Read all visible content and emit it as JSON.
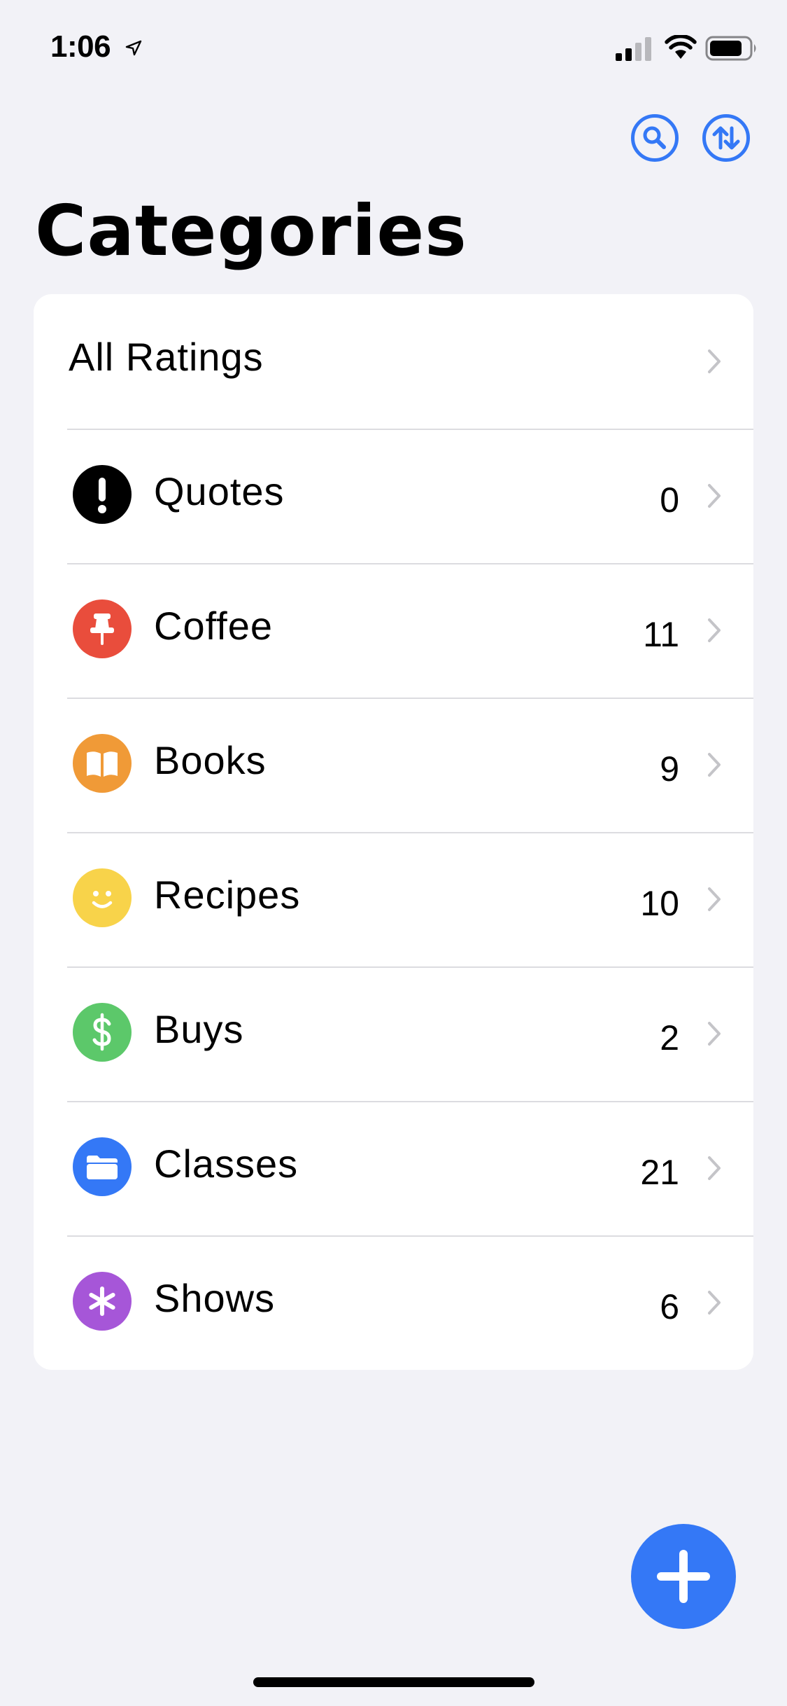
{
  "status_bar": {
    "time": "1:06"
  },
  "nav": {
    "title": "Categories",
    "search_icon": "search-icon",
    "sort_icon": "sort-arrows-icon"
  },
  "all_ratings": {
    "label": "All Ratings"
  },
  "categories": [
    {
      "name": "Quotes",
      "count": "0",
      "icon": "exclamation-icon",
      "color": "#000000"
    },
    {
      "name": "Coffee",
      "count": "11",
      "icon": "pin-icon",
      "color": "#e94d3c"
    },
    {
      "name": "Books",
      "count": "9",
      "icon": "book-icon",
      "color": "#f09a37"
    },
    {
      "name": "Recipes",
      "count": "10",
      "icon": "smiley-icon",
      "color": "#f8d34a"
    },
    {
      "name": "Buys",
      "count": "2",
      "icon": "dollar-icon",
      "color": "#5cc86a"
    },
    {
      "name": "Classes",
      "count": "21",
      "icon": "folder-icon",
      "color": "#3478f6"
    },
    {
      "name": "Shows",
      "count": "6",
      "icon": "asterisk-icon",
      "color": "#a656d8"
    }
  ],
  "fab": {
    "icon": "plus-icon",
    "color": "#3478f6"
  }
}
